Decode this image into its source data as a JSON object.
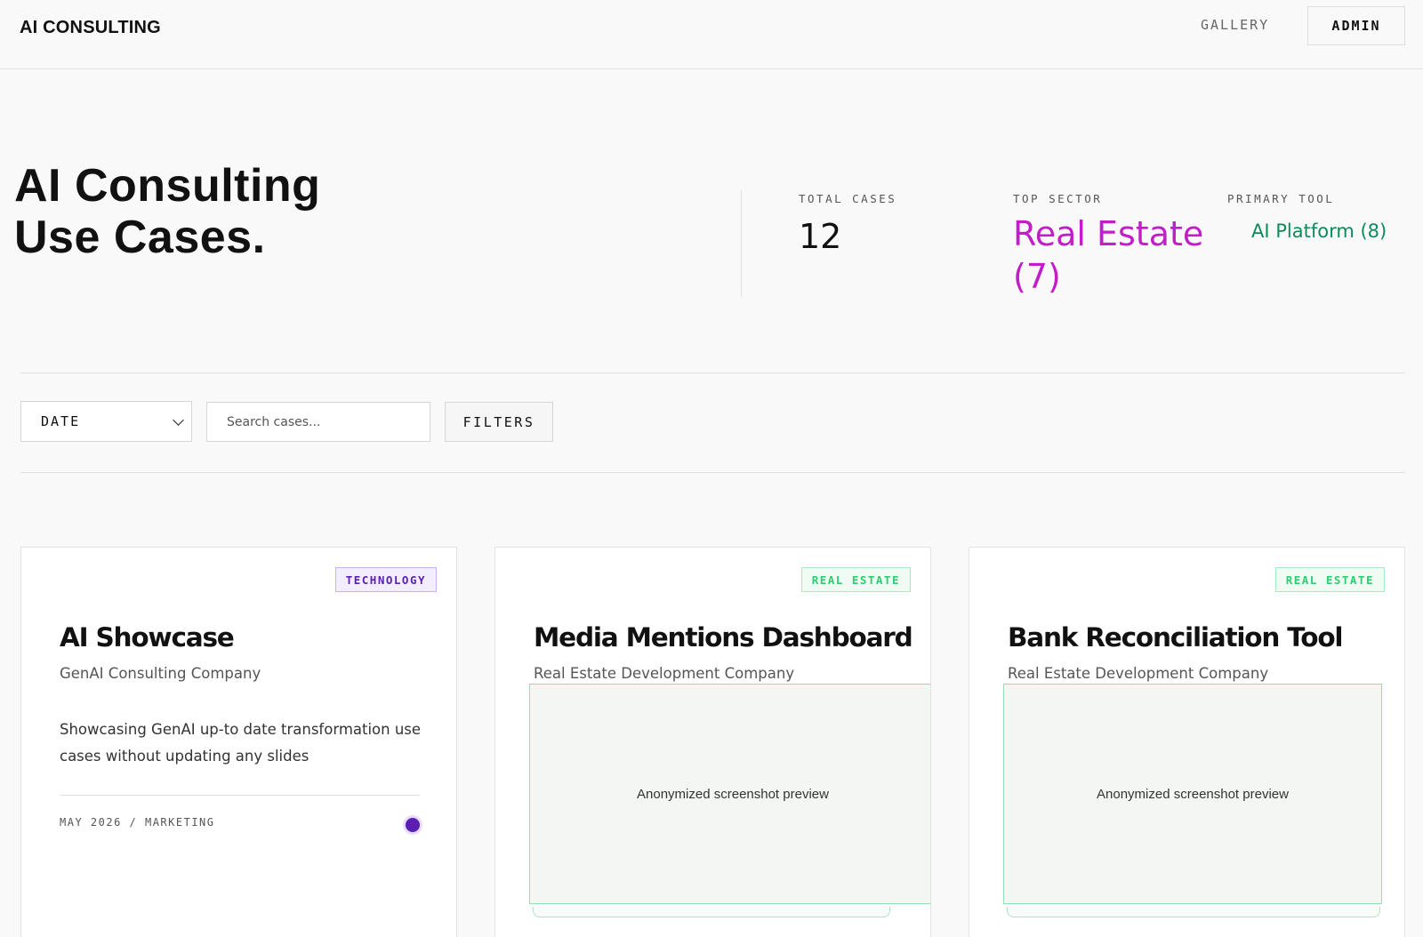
{
  "header": {
    "brand": "AI CONSULTING",
    "nav": {
      "gallery": "GALLERY",
      "admin": "ADMIN"
    }
  },
  "hero": {
    "title_line1": "AI Consulting",
    "title_line2": "Use Cases.",
    "stats": {
      "total_label": "TOTAL CASES",
      "total_value": "12",
      "sector_label": "TOP SECTOR",
      "sector_value": "Real Estate (7)",
      "tool_label": "PRIMARY TOOL",
      "tool_value": "AI Platform (8)"
    }
  },
  "toolbar": {
    "sort_value": "DATE",
    "search_placeholder": "Search cases...",
    "filters_label": "FILTERS"
  },
  "cards": [
    {
      "badge": "TECHNOLOGY",
      "title": "AI Showcase",
      "company": "GenAI Consulting Company",
      "description": "Showcasing GenAI up-to date transformation use cases without updating any slides",
      "meta": "MAY 2026 / MARKETING"
    },
    {
      "badge": "REAL ESTATE",
      "title": "Media Mentions Dashboard",
      "company": "Real Estate Development Company",
      "preview_text": "Anonymized screenshot preview"
    },
    {
      "badge": "REAL ESTATE",
      "title": "Bank Reconciliation Tool",
      "company": "Real Estate Development Company",
      "preview_text": "Anonymized screenshot preview"
    }
  ],
  "colors": {
    "sector_accent": "#c21ec8",
    "tool_accent": "#0f8a5b",
    "technology_badge": "#5b1fb3",
    "real_estate_badge": "#2fcc71"
  }
}
